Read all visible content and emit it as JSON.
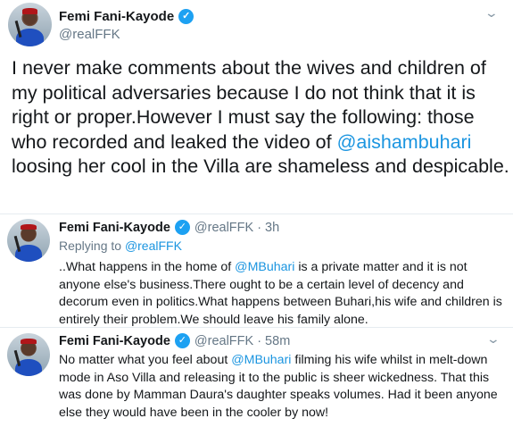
{
  "main": {
    "name": "Femi Fani-Kayode",
    "handle": "@realFFK",
    "text_before": "I never make comments about the wives and children of my political adversaries because I do not think that it is right or proper.However I must say the following: those who recorded and leaked the video of ",
    "mention": "@aishambuhari",
    "text_after": " loosing her cool in the Villa are shameless and despicable."
  },
  "reply1": {
    "name": "Femi Fani-Kayode",
    "meta": "@realFFK · 3h",
    "replying_label": "Replying to ",
    "replying_handle": "@realFFK",
    "text_before": "..What happens in the home of ",
    "mention": "@MBuhari",
    "text_after": " is a private matter and it is not anyone else's business.There ought to be a certain level of decency and decorum even in politics.What happens between Buhari,his wife and children is entirely their problem.We should leave his family alone."
  },
  "reply2": {
    "name": "Femi Fani-Kayode",
    "meta": "@realFFK · 58m",
    "text_before": "No matter what you feel about ",
    "mention": "@MBuhari",
    "text_after": " filming his wife whilst in melt-down mode in Aso Villa and releasing it to the public is sheer wickedness. That this was done by Mamman Daura's daughter speaks volumes. Had it been anyone else they would have been in the cooler by now!"
  },
  "icons": {
    "verified": "verified-badge-icon",
    "chevron": "chevron-down-icon"
  },
  "colors": {
    "mention": "#1b95e0",
    "verified": "#1da1f2",
    "secondary_text": "#657786"
  }
}
